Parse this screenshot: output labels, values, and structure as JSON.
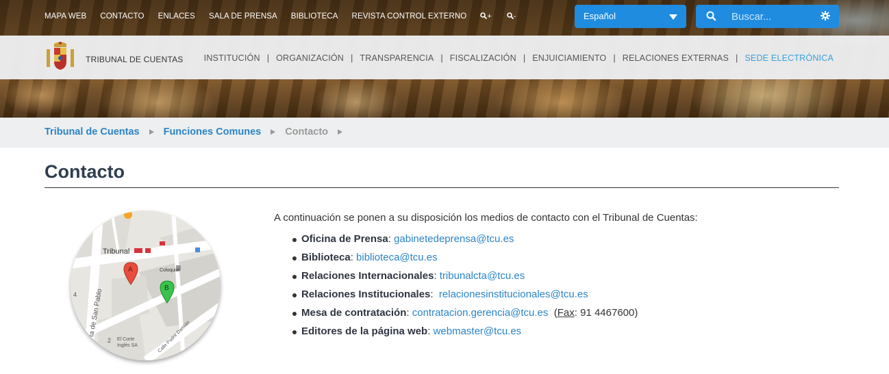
{
  "topnav": {
    "items": [
      "MAPA WEB",
      "CONTACTO",
      "ENLACES",
      "SALA DE PRENSA",
      "BIBLIOTECA",
      "REVISTA CONTROL EXTERNO"
    ],
    "zoom_in": "+",
    "zoom_out": "-"
  },
  "language": {
    "selected": "Español"
  },
  "search": {
    "placeholder": "Buscar..."
  },
  "brand": {
    "name": "TRIBUNAL DE CUENTAS"
  },
  "mainnav": {
    "items": [
      "INSTITUCIÓN",
      "ORGANIZACIÓN",
      "TRANSPARENCIA",
      "FISCALIZACIÓN",
      "ENJUICIAMIENTO",
      "RELACIONES EXTERNAS",
      "SEDE ELECTRÓNICA"
    ]
  },
  "breadcrumb": [
    "Tribunal de Cuentas",
    "Funciones Comunes",
    "Contacto"
  ],
  "page": {
    "title": "Contacto",
    "intro": "A continuación se ponen a su disposición los medios de contacto con el Tribunal de Cuentas:"
  },
  "contacts": [
    {
      "label": "Oficina de Prensa",
      "email": "gabinetedeprensa@tcu.es"
    },
    {
      "label": "Biblioteca",
      "email": "biblioteca@tcu.es"
    },
    {
      "label": "Relaciones Internacionales",
      "email": "tribunalcta@tcu.es"
    },
    {
      "label": "Relaciones Institucionales",
      "email": "relacionesinstitucionales@tcu.es"
    },
    {
      "label": "Mesa de contratación",
      "email": "contratacion.gerencia@tcu.es",
      "fax_label": "Fax",
      "fax_number": "91 4467600"
    },
    {
      "label": "Editores de la página web",
      "email": "webmaster@tcu.es"
    }
  ],
  "map": {
    "labels": {
      "tribunal": "Tribunal",
      "coloquial": "Coloquial",
      "san_pablo": "ta de San Pablo",
      "padre_damian": "Calle Padre Damián",
      "el_corte": "El Corte",
      "ingles": "Inglés SA",
      "num_4": "4",
      "num_2": "2",
      "marker_a": "A",
      "marker_b": "B"
    }
  },
  "colors": {
    "accent": "#1f8ce0",
    "link": "#2a84c6",
    "title": "#2e3e50",
    "active_nav": "#3aa0d8"
  }
}
